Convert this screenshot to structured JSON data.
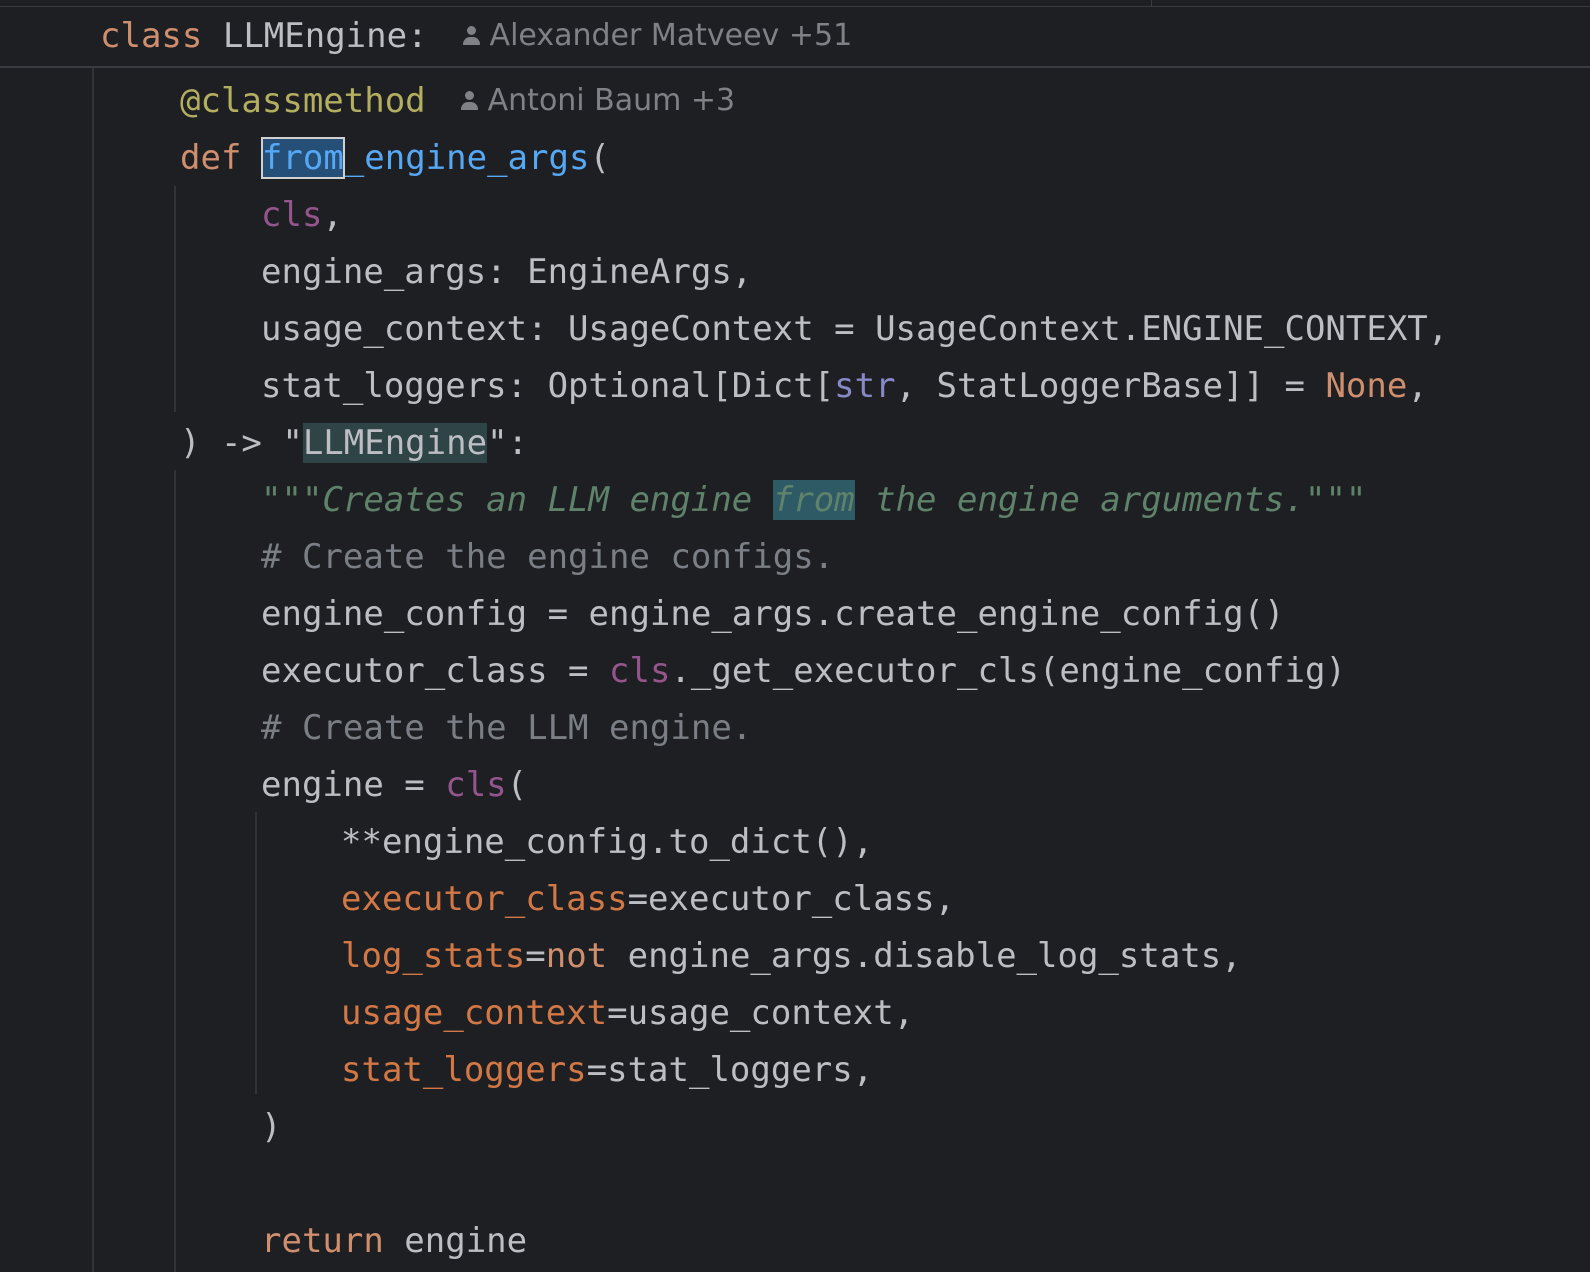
{
  "header": {
    "class_keyword": "class",
    "class_name": "LLMEngine:",
    "blame": "Alexander Matveev +51"
  },
  "method_blame": "Antoni Baum +3",
  "code": {
    "decorator": "@classmethod",
    "def_kw": "def",
    "fn_sel": "from",
    "fn_rest": "_engine_args",
    "open_paren": "(",
    "p_cls": "cls",
    "comma": ",",
    "p_engine_args": "engine_args: EngineArgs,",
    "p_usage_a": "usage_context: UsageContext = UsageContext.ENGINE_CONTEXT,",
    "p_stat_a": "stat_loggers: Optional[Dict[",
    "p_stat_str": "str",
    "p_stat_b": ", StatLoggerBase]] = ",
    "p_stat_none": "None",
    "p_stat_c": ",",
    "ret_a": ") -> \"",
    "ret_name": "LLMEngine",
    "ret_b": "\":",
    "doc_a": "\"\"\"Creates an LLM engine ",
    "doc_from": "from",
    "doc_b": " the engine arguments.\"\"\"",
    "comment1": "# Create the engine configs.",
    "engine_config": "engine_config = engine_args.create_engine_config()",
    "exec_a": "executor_class = ",
    "exec_cls": "cls",
    "exec_b": "._get_executor_cls(engine_config)",
    "comment2": "# Create the LLM engine.",
    "engine_a": "engine = ",
    "engine_cls": "cls",
    "engine_b": "(",
    "kw_dict": "**engine_config.to_dict(),",
    "kw_exec_name": "executor_class",
    "kw_exec_val": "=executor_class,",
    "kw_log_name": "log_stats",
    "kw_log_eq": "=",
    "kw_log_not": "not",
    "kw_log_val": " engine_args.disable_log_stats,",
    "kw_usage_name": "usage_context",
    "kw_usage_val": "=usage_context,",
    "kw_stat_name": "stat_loggers",
    "kw_stat_val": "=stat_loggers,",
    "close_paren": ")",
    "return_kw": "return",
    "return_val": " engine"
  },
  "colors": {
    "background": "#1e1f22",
    "keyword": "#cf8e6d",
    "function": "#56a8f5",
    "self": "#94558d",
    "decorator": "#b3ae60",
    "docstring": "#5f826b",
    "comment": "#7a7e85",
    "named_arg": "#d27846",
    "builtin": "#8888c6",
    "text": "#bcbec4"
  },
  "icons": {
    "author": "person-icon"
  }
}
